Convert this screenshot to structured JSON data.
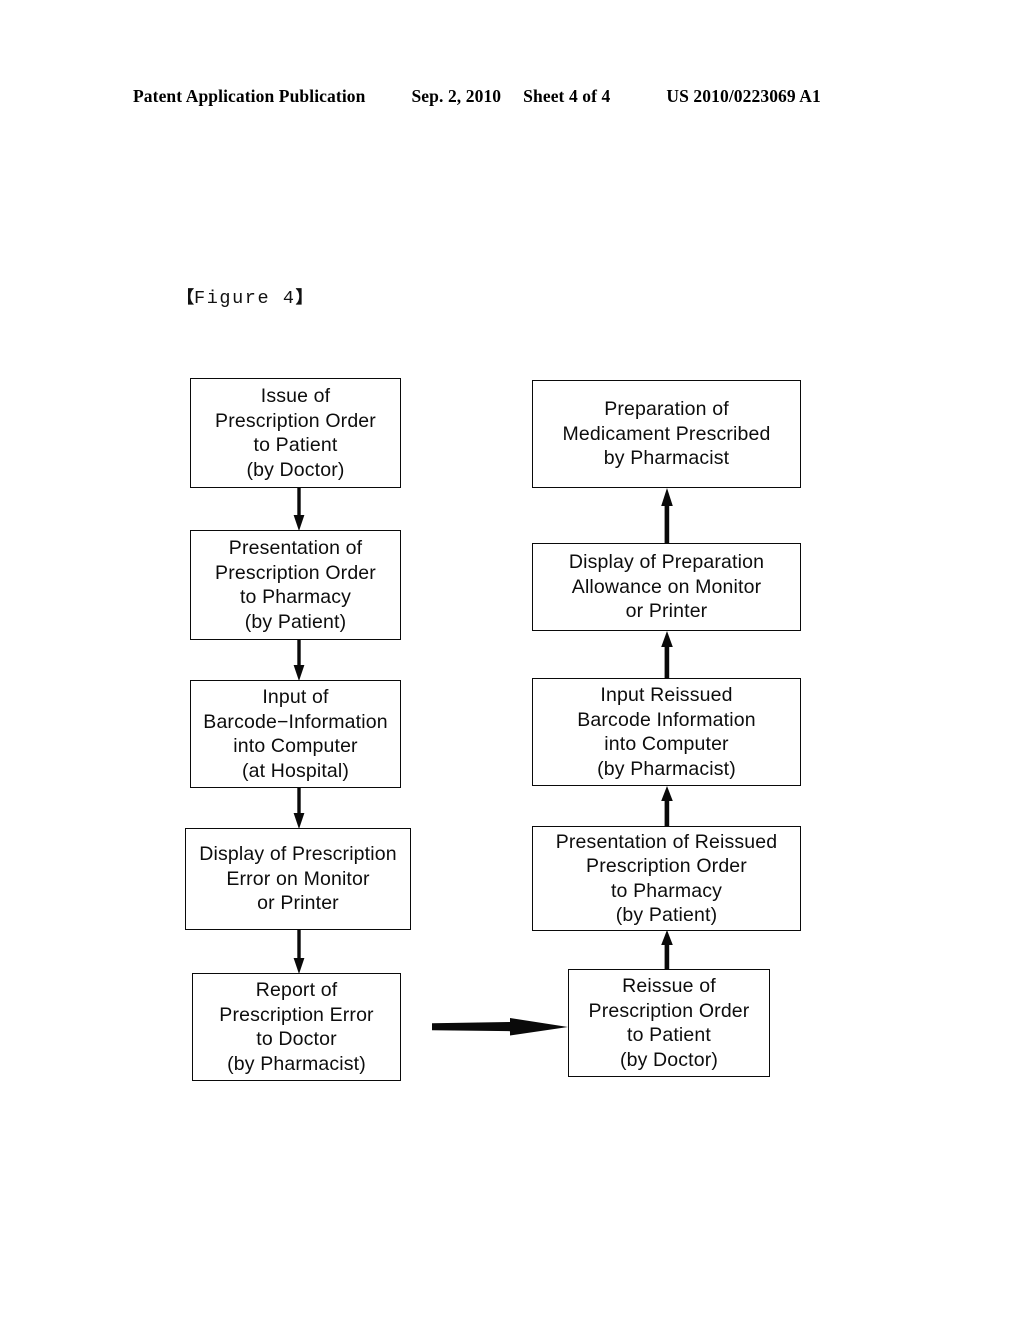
{
  "header": {
    "publication": "Patent Application Publication",
    "date": "Sep. 2, 2010",
    "sheet": "Sheet 4 of 4",
    "patent_number": "US 2010/0223069 A1"
  },
  "figure": {
    "bracket_open": "【",
    "bracket_close": "】",
    "label": "Figure 4"
  },
  "diagram": {
    "left_column": [
      {
        "id": "issue-prescription-order",
        "lines": [
          "Issue of",
          "Prescription Order",
          "to Patient",
          "(by Doctor)"
        ]
      },
      {
        "id": "presentation-prescription-order",
        "lines": [
          "Presentation of",
          "Prescription Order",
          "to Pharmacy",
          "(by Patient)"
        ]
      },
      {
        "id": "input-barcode-information",
        "lines": [
          "Input of",
          "Barcode−Information",
          "into Computer",
          "(at Hospital)"
        ]
      },
      {
        "id": "display-prescription-error",
        "lines": [
          "Display of Prescription",
          "Error on Monitor",
          "or Printer"
        ]
      },
      {
        "id": "report-prescription-error",
        "lines": [
          "Report of",
          "Prescription Error",
          "to Doctor",
          "(by Pharmacist)"
        ]
      }
    ],
    "right_column": [
      {
        "id": "preparation-medicament",
        "lines": [
          "Preparation of",
          "Medicament Prescribed",
          "by Pharmacist"
        ]
      },
      {
        "id": "display-preparation-allowance",
        "lines": [
          "Display of Preparation",
          "Allowance on Monitor",
          "or Printer"
        ]
      },
      {
        "id": "input-reissued-barcode",
        "lines": [
          "Input Reissued",
          "Barcode Information",
          "into Computer",
          "(by Pharmacist)"
        ]
      },
      {
        "id": "presentation-reissued-order",
        "lines": [
          "Presentation of Reissued",
          "Prescription Order",
          "to Pharmacy",
          "(by Patient)"
        ]
      },
      {
        "id": "reissue-prescription-order",
        "lines": [
          "Reissue of",
          "Prescription Order",
          "to Patient",
          "(by Doctor)"
        ]
      }
    ],
    "connectors": {
      "left_direction": "down",
      "right_direction": "up",
      "cross_direction": "right",
      "line_color": "#0a0a0a"
    }
  }
}
